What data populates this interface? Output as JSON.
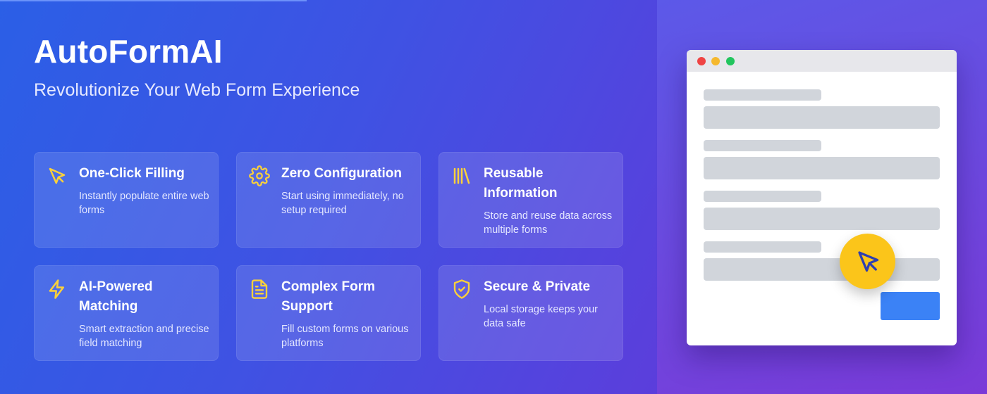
{
  "brand": {
    "title": "AutoFormAI",
    "subtitle": "Revolutionize Your Web Form Experience"
  },
  "features": [
    {
      "icon": "cursor-click-icon",
      "title": "One-Click Filling",
      "description": "Instantly populate entire web forms"
    },
    {
      "icon": "gear-icon",
      "title": "Zero Configuration",
      "description": "Start using immediately, no setup required"
    },
    {
      "icon": "library-icon",
      "title": "Reusable Information",
      "description": "Store and reuse data across multiple forms"
    },
    {
      "icon": "lightning-icon",
      "title": "AI-Powered Matching",
      "description": "Smart extraction and precise field matching"
    },
    {
      "icon": "document-icon",
      "title": "Complex Form Support",
      "description": "Fill custom forms on various platforms"
    },
    {
      "icon": "shield-check-icon",
      "title": "Secure & Private",
      "description": "Local storage keeps your data safe"
    }
  ],
  "mockup": {
    "window_controls": [
      "close-dot",
      "minimize-dot",
      "maximize-dot"
    ],
    "form_field_count": 4,
    "cursor_icon": "mouse-pointer-icon"
  },
  "colors": {
    "accent_icon": "#fbd13a",
    "cursor_badge": "#fbc51a",
    "submit_button": "#3b82f6",
    "background_start": "#2b5fe6",
    "background_end": "#6a2fd4"
  }
}
